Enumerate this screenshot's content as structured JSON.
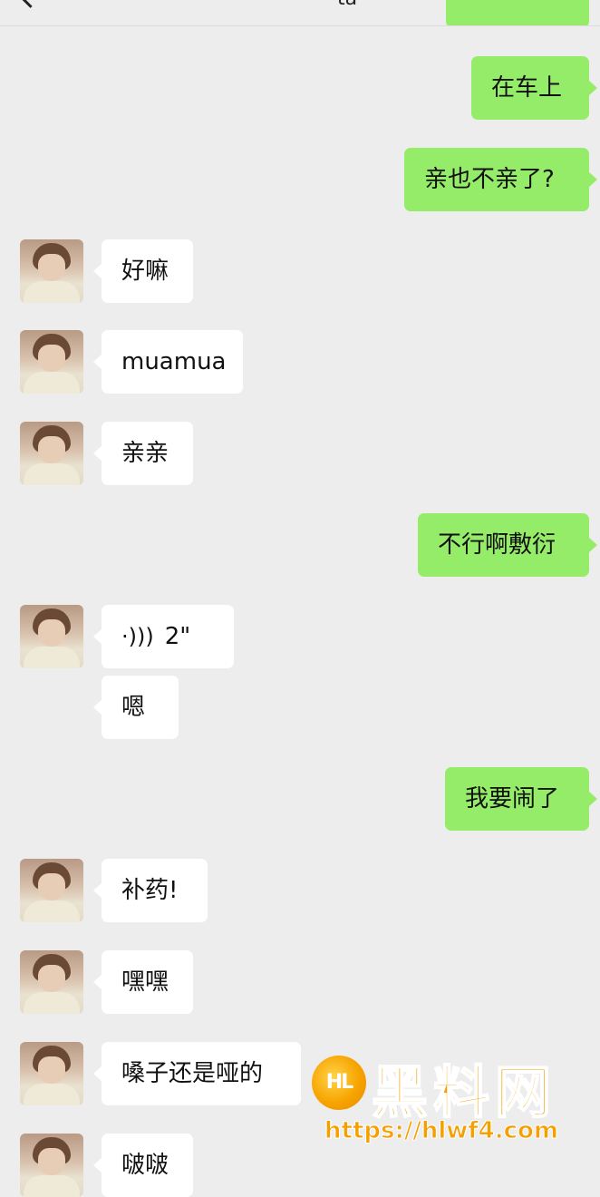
{
  "header": {
    "title_fragment": "ta"
  },
  "messages": [
    {
      "side": "out",
      "text": "在车上"
    },
    {
      "side": "out",
      "text": "亲也不亲了?"
    },
    {
      "side": "in",
      "text": "好嘛"
    },
    {
      "side": "in",
      "text": "muamua"
    },
    {
      "side": "in",
      "text": "亲亲"
    },
    {
      "side": "out",
      "text": "不行啊敷衍"
    },
    {
      "side": "in",
      "type": "voice",
      "duration": "2\""
    },
    {
      "side": "in",
      "text": "嗯",
      "no_avatar": true
    },
    {
      "side": "out",
      "text": "我要闹了"
    },
    {
      "side": "in",
      "text": "补药!"
    },
    {
      "side": "in",
      "text": "嘿嘿"
    },
    {
      "side": "in",
      "text": "嗓子还是哑的"
    },
    {
      "side": "in",
      "text": "啵啵"
    }
  ],
  "watermark": {
    "logo": "HL",
    "title": "黑料网",
    "url": "https://hlwf4.com"
  },
  "colors": {
    "background": "#ededed",
    "outgoing_bubble": "#95ec69",
    "incoming_bubble": "#ffffff",
    "watermark": "#f5a000"
  }
}
